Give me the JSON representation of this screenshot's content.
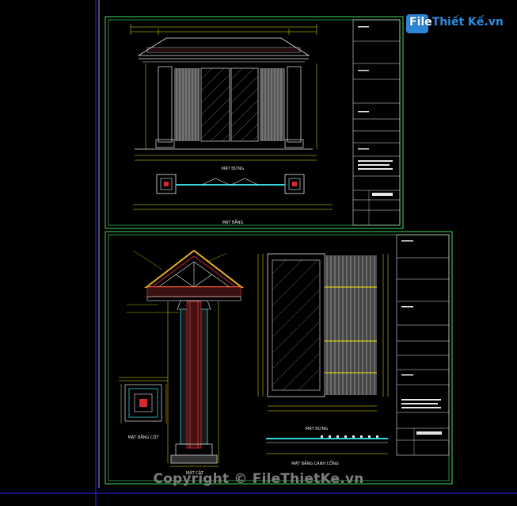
{
  "watermark": {
    "logo_brand_prefix": "File",
    "logo_brand_rest": "Thiết Kế",
    "logo_domain": ".vn",
    "copyright": "Copyright © FileThietKe.vn"
  },
  "sheet_top": {
    "elevation_title": "MẶT ĐỨNG",
    "plan_title": "MẶT BẰNG"
  },
  "sheet_bottom": {
    "section_title": "MẶT CẮT",
    "column_plan_title": "MẶT BẰNG CỘT",
    "gate_elevation_title": "MẶT ĐỨNG",
    "gate_plan_title": "MẶT BẰNG CÁNH CỔNG"
  },
  "colors": {
    "background": "#000000",
    "frame": "#39b54a",
    "dimension": "#f2e600",
    "linework": "#e6e6e6",
    "hatch_red": "#d8282e",
    "cyan": "#35d3d8",
    "gold": "#e8b020",
    "crosshair_blue": "#2d2dff",
    "logo_blue": "#2d8fe0"
  }
}
